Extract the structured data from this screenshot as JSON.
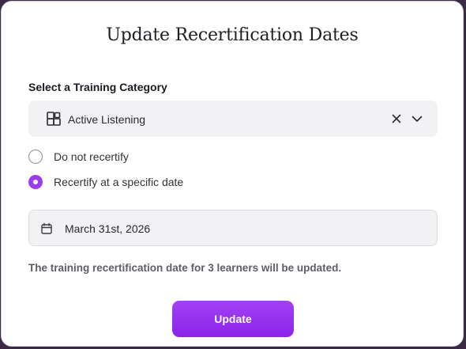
{
  "modal": {
    "title": "Update Recertification Dates"
  },
  "category": {
    "label": "Select a Training Category",
    "selected": "Active Listening",
    "icon": "category-icon"
  },
  "recertify_options": [
    {
      "label": "Do not recertify",
      "checked": false
    },
    {
      "label": "Recertify at a specific date",
      "checked": true
    }
  ],
  "date": {
    "value": "March 31st, 2026",
    "icon": "calendar-icon"
  },
  "info_text": "The training recertification date for 3 learners will be updated.",
  "update_button": "Update",
  "colors": {
    "accent": "#9b3dee",
    "field_bg": "#f2f2f4"
  }
}
